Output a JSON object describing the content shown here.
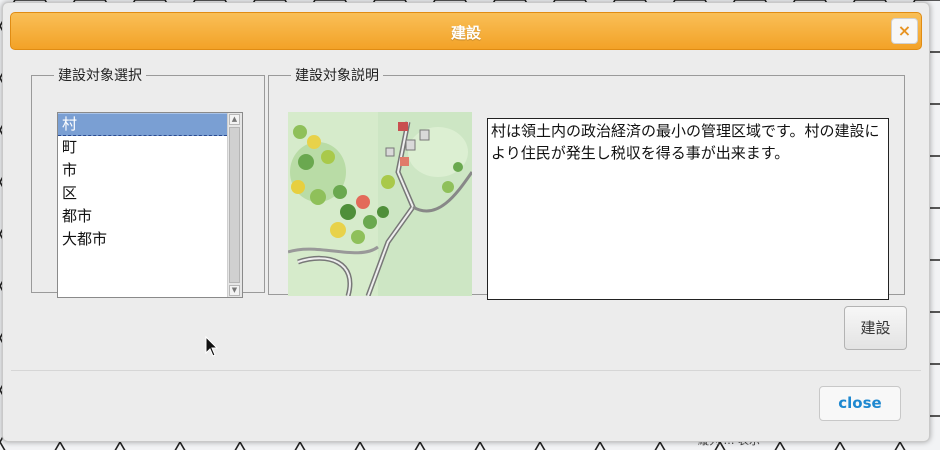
{
  "dialog": {
    "title": "建設",
    "close_icon": "×",
    "close_label": "close",
    "build_label": "建設"
  },
  "selection": {
    "legend": "建設対象選択",
    "items": [
      "村",
      "町",
      "市",
      "区",
      "都市",
      "大都市"
    ],
    "selected": "村"
  },
  "detail": {
    "legend": "建設対象説明",
    "description": "村は領土内の政治経済の最小の管理区域です。村の建設により住民が発生し税収を得る事が出来ます。"
  },
  "background": {
    "text": "縦列 … 表示"
  },
  "colors": {
    "title_bar": "#f3a227",
    "selected_item": "#7a9fd3",
    "close_text": "#1e88d0"
  }
}
